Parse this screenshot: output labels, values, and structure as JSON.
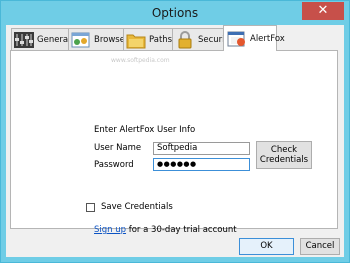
{
  "window": {
    "title": "Options",
    "close_glyph": "✕"
  },
  "tabs": [
    {
      "label": "General",
      "icon": "equalizer-icon",
      "active": false
    },
    {
      "label": "Browser",
      "icon": "browser-window-icon",
      "active": false
    },
    {
      "label": "Paths",
      "icon": "folder-icon",
      "active": false
    },
    {
      "label": "Security",
      "icon": "padlock-icon",
      "active": false
    },
    {
      "label": "AlertFox",
      "icon": "alertfox-icon",
      "active": true
    }
  ],
  "panel": {
    "watermark": "www.softpedia.com",
    "section_title": "Enter AlertFox User Info",
    "username_label": "User Name",
    "username_value": "Softpedia",
    "password_label": "Password",
    "password_value": "●●●●●●",
    "check_button_line1": "Check",
    "check_button_line2": "Credentials",
    "save_credentials_label": "Save Credentials",
    "save_credentials_checked": false,
    "signup_link": "Sign up",
    "signup_rest": "for a 30-day trial account"
  },
  "footer": {
    "ok_label": "OK",
    "cancel_label": "Cancel"
  },
  "colors": {
    "title_bar": "#6fcde6",
    "close_button": "#c7504a",
    "link": "#0b53c4",
    "focus_border": "#3c8fd8"
  }
}
